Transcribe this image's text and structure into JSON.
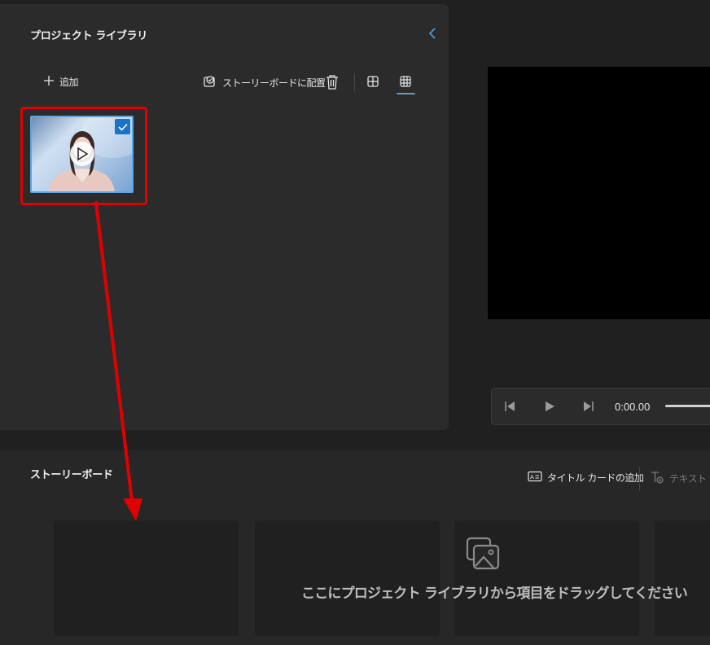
{
  "library": {
    "title": "プロジェクト ライブラリ",
    "add_label": "追加",
    "place_label": "ストーリーボードに配置",
    "icons": [
      "chevron-left-icon",
      "plus-icon",
      "storyboard-place-icon",
      "trash-icon",
      "large-grid-icon",
      "small-grid-icon"
    ],
    "selected_view": "small-grid",
    "thumbnail": {
      "selected": true
    }
  },
  "player": {
    "time": "0:00.00",
    "icons": [
      "skip-back-icon",
      "play-icon",
      "skip-forward-icon"
    ]
  },
  "storyboard": {
    "title": "ストーリーボード",
    "title_card_label": "タイトル カードの追加",
    "text_label": "テキスト",
    "drop_message": "ここにプロジェクト ライブラリから項目をドラッグしてください"
  },
  "colors": {
    "accent": "#4aa1e6",
    "highlight": "#e00000",
    "panel": "#2b2b2b",
    "background": "#202020"
  }
}
